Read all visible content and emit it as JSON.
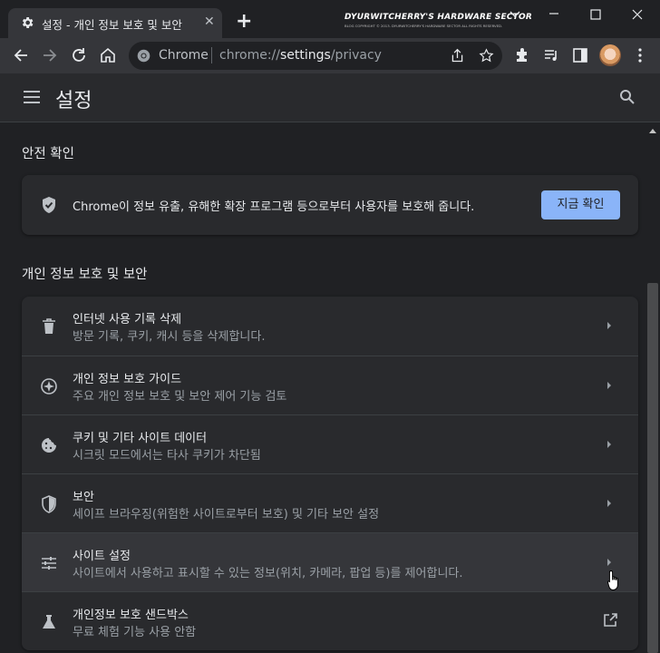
{
  "tab": {
    "title": "설정 - 개인 정보 보호 및 보안",
    "icon": "gear-icon"
  },
  "branding": {
    "line1": "DYURWITCHERRY'S HARDWARE SECTOR",
    "line2": "BLOG COPYRIGHT © 2013. DYURWITCHERRY'S HARDWARE SECTOR ALL RIGHTS RESERVED."
  },
  "omnibox": {
    "site_label": "Chrome",
    "url_scheme": "chrome://",
    "url_host": "settings",
    "url_path": "/privacy"
  },
  "header": {
    "title": "설정"
  },
  "safety": {
    "heading": "안전 확인",
    "text": "Chrome이 정보 유출, 유해한 확장 프로그램 등으로부터 사용자를 보호해 줍니다.",
    "button": "지금 확인"
  },
  "privacy": {
    "heading": "개인 정보 보호 및 보안",
    "items": [
      {
        "title": "인터넷 사용 기록 삭제",
        "subtitle": "방문 기록, 쿠키, 캐시 등을 삭제합니다.",
        "icon": "trash-icon"
      },
      {
        "title": "개인 정보 보호 가이드",
        "subtitle": "주요 개인 정보 보호 및 보안 제어 기능 검토",
        "icon": "compass-icon"
      },
      {
        "title": "쿠키 및 기타 사이트 데이터",
        "subtitle": "시크릿 모드에서는 타사 쿠키가 차단됨",
        "icon": "cookie-icon"
      },
      {
        "title": "보안",
        "subtitle": "세이프 브라우징(위험한 사이트로부터 보호) 및 기타 보안 설정",
        "icon": "shield-icon"
      },
      {
        "title": "사이트 설정",
        "subtitle": "사이트에서 사용하고 표시할 수 있는 정보(위치, 카메라, 팝업 등)를 제어합니다.",
        "icon": "tune-icon"
      },
      {
        "title": "개인정보 보호 샌드박스",
        "subtitle": "무료 체험 기능 사용 안함",
        "icon": "flask-icon"
      }
    ]
  },
  "colors": {
    "accent": "#8ab4f8",
    "background": "#202124",
    "card": "#292a2d"
  }
}
